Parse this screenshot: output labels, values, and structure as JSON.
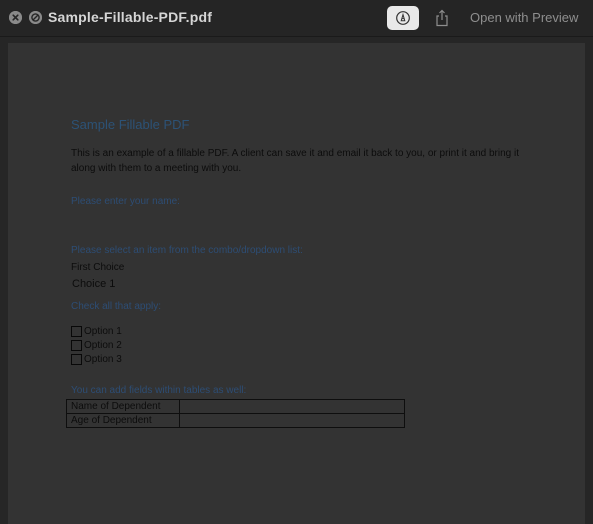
{
  "titlebar": {
    "filename": "Sample-Fillable-PDF.pdf",
    "open_with_label": "Open with Preview"
  },
  "icons": {
    "close": "close-icon",
    "block": "block-icon",
    "markup": "markup-pen-icon",
    "share": "share-icon"
  },
  "document": {
    "title": "Sample Fillable PDF",
    "intro": "This is an example of a fillable PDF. A client can save it and email it back to you, or print it and bring it along with them to a meeting with you.",
    "name_prompt": "Please enter your name:",
    "combo_prompt": "Please select an item from the combo/dropdown list:",
    "combo_field_label": "First Choice",
    "combo_value": "Choice 1",
    "check_prompt": "Check all that apply:",
    "options": [
      "Option 1",
      "Option 2",
      "Option 3"
    ],
    "table_prompt": "You can add  fields within tables as well:",
    "table_rows": [
      {
        "label": "Name of Dependent",
        "value": ""
      },
      {
        "label": "Age of Dependent",
        "value": ""
      }
    ]
  },
  "colors": {
    "heading_blue": "#2c5276",
    "markup_button": "#e9e9e9"
  }
}
